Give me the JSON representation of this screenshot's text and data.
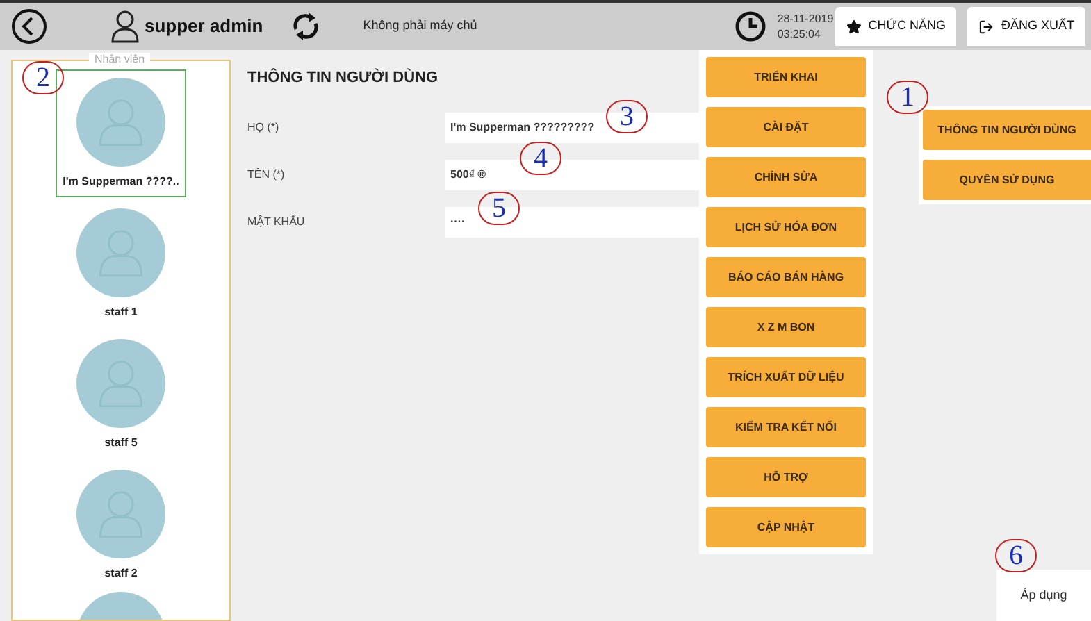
{
  "top_bar": {
    "user": "supper admin",
    "server_status": "Không phải máy chủ",
    "date": "28-11-2019",
    "time": "03:25:04",
    "buttons": [
      {
        "label": "CHỨC NĂNG",
        "kind": "star"
      },
      {
        "label": "ĐĂNG XUẤT",
        "kind": "logout"
      }
    ]
  },
  "staff_panel": {
    "legend": "Nhân viên",
    "items": [
      {
        "name": "I'm Supperman ????..",
        "selected": true
      },
      {
        "name": "staff 1",
        "selected": false
      },
      {
        "name": "staff 5",
        "selected": false
      },
      {
        "name": "staff 2",
        "selected": false
      }
    ]
  },
  "form": {
    "title": "THÔNG TIN NGƯỜI DÙNG",
    "fields": [
      {
        "label": "HỌ (*)",
        "value": "I'm Supperman ?????????"
      },
      {
        "label": "TÊN (*)",
        "value": "500₫ ®"
      },
      {
        "label": "MẬT KHẨU",
        "value": "····"
      }
    ]
  },
  "menu": {
    "items": [
      "TRIỂN KHAI",
      "CÀI ĐẶT",
      "CHỈNH SỬA",
      "LỊCH SỬ HÓA ĐƠN",
      "BÁO CÁO BÁN HÀNG",
      "X Z M BON",
      "TRÍCH XUẤT DỮ LIỆU",
      "KIỂM TRA KẾT NỐI",
      "HỖ TRỢ",
      "CẬP NHẬT"
    ],
    "submenu": [
      "THÔNG TIN NGƯỜI DÙNG",
      "QUYỀN SỬ DỤNG"
    ]
  },
  "apply_button": "Áp dụng",
  "callouts": [
    "1",
    "2",
    "3",
    "4",
    "5",
    "6"
  ]
}
